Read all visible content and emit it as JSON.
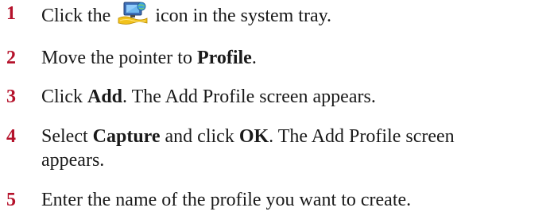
{
  "steps": [
    {
      "number": "1",
      "before": "Click the",
      "icon": "network-tray-icon",
      "after": "icon in the system tray."
    },
    {
      "number": "2",
      "before": "Move the pointer to",
      "bold": "Profile",
      "after": "."
    },
    {
      "number": "3",
      "before": "Click",
      "bold": "Add",
      "after": ". The Add Profile screen appears."
    },
    {
      "number": "4",
      "before": "Select",
      "bold": "Capture",
      "middle": "and click",
      "bold2": "OK",
      "after": ". The Add Profile screen",
      "after_line2": "appears."
    },
    {
      "number": "5",
      "before": "Enter the name of the profile you want to create."
    }
  ],
  "colors": {
    "step_number": "#b5122b",
    "text": "#1a1a1a"
  }
}
